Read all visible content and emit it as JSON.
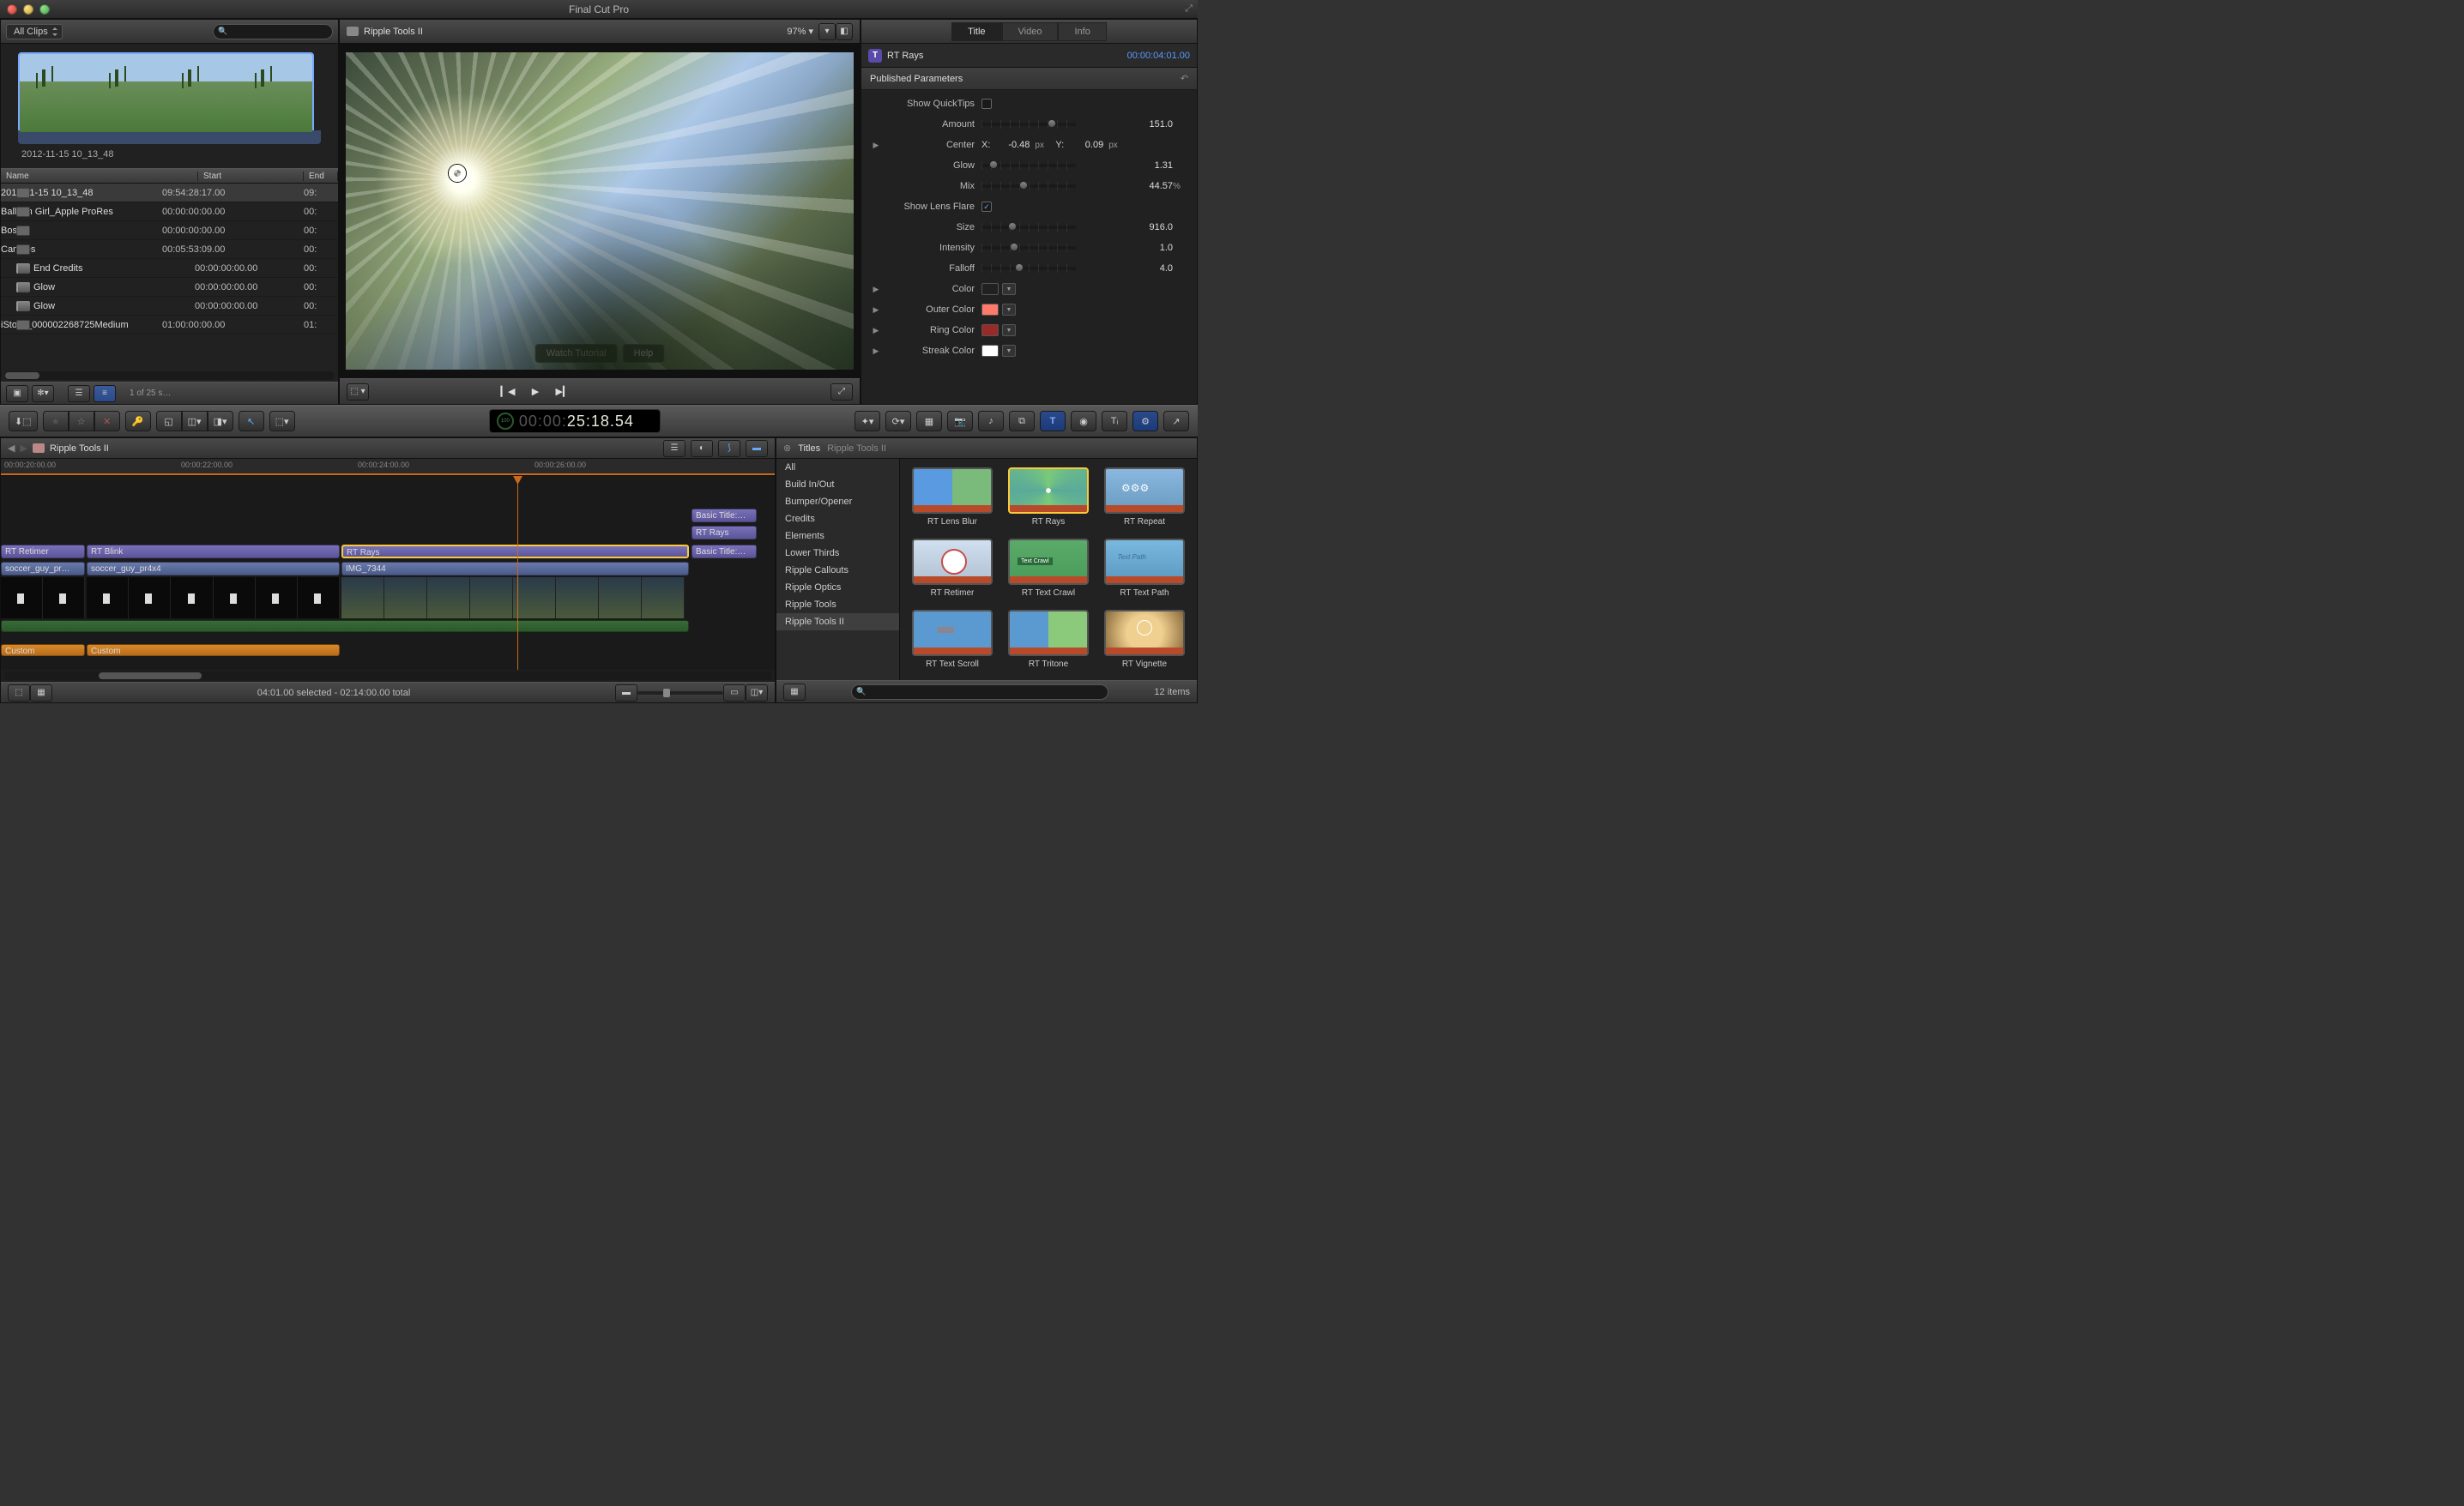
{
  "app": {
    "title": "Final Cut Pro"
  },
  "browser": {
    "filter": "All Clips",
    "thumb_name": "2012-11-15 10_13_48",
    "columns": {
      "name": "Name",
      "start": "Start",
      "end": "End"
    },
    "clips": [
      {
        "name": "2012-11-15 10_13_48",
        "start": "09:54:28:17.00",
        "end": "09:",
        "icon": "clip",
        "sel": true
      },
      {
        "name": "Balloon Girl_Apple ProRes",
        "start": "00:00:00:00.00",
        "end": "00:",
        "icon": "clip"
      },
      {
        "name": "Boston",
        "start": "00:00:00:00.00",
        "end": "00:",
        "icon": "clip"
      },
      {
        "name": "Candles",
        "start": "00:05:53:09.00",
        "end": "00:",
        "icon": "clip"
      },
      {
        "name": "End Credits",
        "start": "00:00:00:00.00",
        "end": "00:",
        "icon": "proj"
      },
      {
        "name": "Glow",
        "start": "00:00:00:00.00",
        "end": "00:",
        "icon": "proj"
      },
      {
        "name": "Glow",
        "start": "00:00:00:00.00",
        "end": "00:",
        "icon": "proj"
      },
      {
        "name": "iStock_000002268725Medium",
        "start": "01:00:00:00.00",
        "end": "01:",
        "icon": "clip"
      }
    ],
    "status": "1 of 25 s…"
  },
  "viewer": {
    "project": "Ripple Tools II",
    "zoom": "97%",
    "buttons": {
      "tutorial": "Watch Tutorial",
      "help": "Help"
    }
  },
  "inspector": {
    "tabs": {
      "title": "Title",
      "video": "Video",
      "info": "Info"
    },
    "name": "RT Rays",
    "timecode": "00:00:04:01.00",
    "section": "Published Parameters",
    "params": {
      "quicktips_label": "Show QuickTips",
      "amount_label": "Amount",
      "amount_val": "151.0",
      "center_label": "Center",
      "center_x_lbl": "X:",
      "center_x": "-0.48",
      "center_x_unit": "px",
      "center_y_lbl": "Y:",
      "center_y": "0.09",
      "center_y_unit": "px",
      "glow_label": "Glow",
      "glow_val": "1.31",
      "mix_label": "Mix",
      "mix_val": "44.57",
      "mix_unit": "%",
      "lensflare_label": "Show Lens Flare",
      "size_label": "Size",
      "size_val": "916.0",
      "intensity_label": "Intensity",
      "intensity_val": "1.0",
      "falloff_label": "Falloff",
      "falloff_val": "4.0",
      "color_label": "Color",
      "color_val": "#ffffff",
      "outer_label": "Outer Color",
      "outer_val": "#ff7a6a",
      "ring_label": "Ring Color",
      "ring_val": "#9a2a2a",
      "streak_label": "Streak Color",
      "streak_val": "#ffffff"
    }
  },
  "timecode": {
    "display": "25:18.54",
    "prefix": "00:00:"
  },
  "timeline": {
    "project": "Ripple Tools II",
    "marks": [
      "00:00:20:00.00",
      "00:00:22:00.00",
      "00:00:24:00.00",
      "00:00:26:00.00"
    ],
    "clips": {
      "basic1": "Basic Title:…",
      "rtrays_top": "RT Rays",
      "retimer": "RT Retimer",
      "blink": "RT Blink",
      "rtrays_mid": "RT Rays",
      "basic2": "Basic Title:…",
      "soccer1": "soccer_guy_pr…",
      "soccer2": "soccer_guy_pr4x4",
      "img": "IMG_7344",
      "custom1": "Custom",
      "custom2": "Custom"
    },
    "footer_status": "04:01.00 selected - 02:14:00.00 total"
  },
  "titles_browser": {
    "header": "Titles",
    "subtitle": "Ripple Tools II",
    "categories": [
      "All",
      "Build In/Out",
      "Bumper/Opener",
      "Credits",
      "Elements",
      "Lower Thirds",
      "Ripple Callouts",
      "Ripple Optics",
      "Ripple Tools",
      "Ripple Tools II"
    ],
    "items": [
      {
        "name": "RT Lens Blur",
        "cls": "th-lens"
      },
      {
        "name": "RT Rays",
        "cls": "th-rays",
        "sel": true
      },
      {
        "name": "RT Repeat",
        "cls": "th-repeat"
      },
      {
        "name": "RT Retimer",
        "cls": "th-retimer"
      },
      {
        "name": "RT Text Crawl",
        "cls": "th-crawl"
      },
      {
        "name": "RT Text Path",
        "cls": "th-path"
      },
      {
        "name": "RT Text Scroll",
        "cls": "th-scroll"
      },
      {
        "name": "RT Tritone",
        "cls": "th-tritone"
      },
      {
        "name": "RT Vignette",
        "cls": "th-vignette"
      }
    ],
    "count": "12 items"
  }
}
